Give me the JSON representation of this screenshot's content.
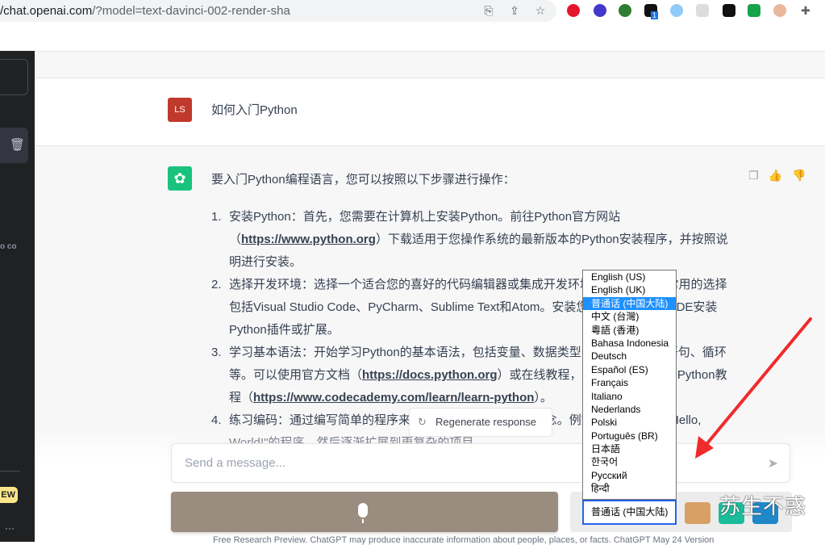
{
  "browser": {
    "url_host": "/chat.openai.com",
    "url_path": "/?model=text-davinci-002-render-sha",
    "ext_badge": "1"
  },
  "sidebar": {
    "badge": "EW",
    "more": "···",
    "partial_text": "o co"
  },
  "user": {
    "initials": "LS",
    "avatar_color": "#c0392b",
    "message": "如何入门Python"
  },
  "assistant": {
    "avatar_color": "#19c37d",
    "intro": "要入门Python编程语言，您可以按照以下步骤进行操作：",
    "steps": [
      {
        "num": "1.",
        "parts": [
          "安装Python：首先，您需要在计算机上安装Python。前往Python官方网站（",
          "https://www.python.org",
          "）下载适用于您操作系统的最新版本的Python安装程序，并按照说明进行安装。"
        ]
      },
      {
        "num": "2.",
        "parts": [
          "选择开发环境：选择一个适合您的喜好的代码编辑器或集成开发环境（IDE）。一些常用的选择包括Visual Studio Code、PyCharm、Sublime Text和Atom。安装您选择的编辑器或IDE安装Python插件或扩展。"
        ]
      },
      {
        "num": "3.",
        "parts": [
          "学习基本语法：开始学习Python的基本语法，包括变量、数据类型、运算符、条件语句、循环等。可以使用官方文档（",
          "https://docs.python.org",
          "）或在线教程，如Codecademy的Python教程（",
          "https://www.codecademy.com/learn/learn-python",
          "）。"
        ]
      },
      {
        "num": "4.",
        "parts": [
          "练习编码：通过编写简单的程序来练习Python的一些基本概念。例如编写一个打印\"Hello, World!\"的程序，然后逐渐扩展到更复杂的项目。"
        ]
      }
    ]
  },
  "composer": {
    "regenerate": "Regenerate response",
    "placeholder": "Send a message..."
  },
  "languages": {
    "options": [
      "English (US)",
      "English (UK)",
      "普通话 (中国大陆)",
      "中文 (台灣)",
      "粵語 (香港)",
      "Bahasa Indonesia",
      "Deutsch",
      "Español (ES)",
      "Français",
      "Italiano",
      "Nederlands",
      "Polski",
      "Português (BR)",
      "日本語",
      "한국어",
      "Русский",
      "हिन्दी"
    ],
    "selected": "普通话 (中国大陆)"
  },
  "watermark": "苏生不惑",
  "footer": "Free Research Preview. ChatGPT may produce inaccurate information about people, places, or facts. ChatGPT May 24 Version"
}
